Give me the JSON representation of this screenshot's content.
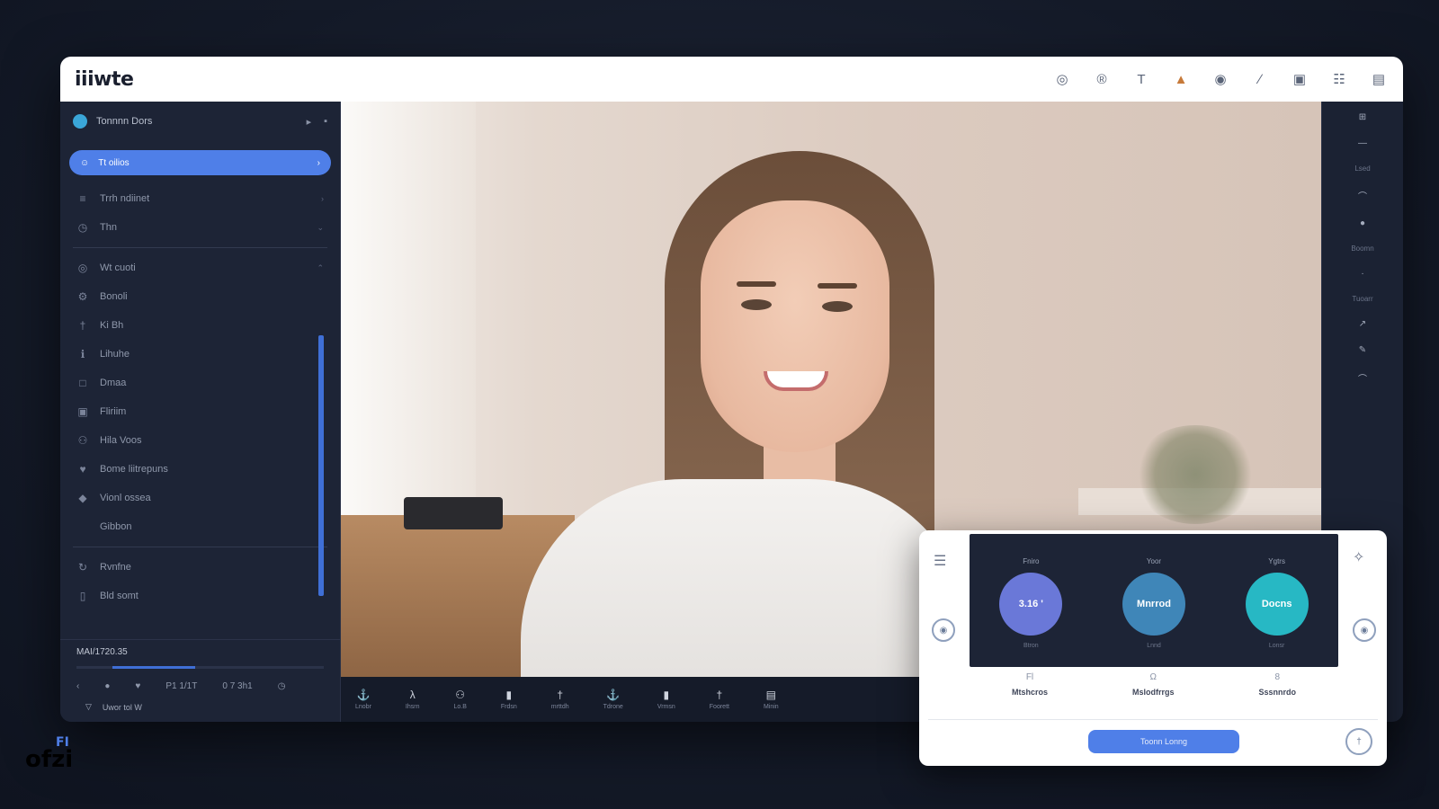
{
  "app": {
    "logo_text": "iiiwte"
  },
  "toolbar": {
    "icons": [
      "spiral-icon",
      "at-icon",
      "text-icon",
      "cat-icon",
      "circle-q-icon",
      "italic-icon",
      "image-icon",
      "grid-icon",
      "stack-icon"
    ]
  },
  "sidebar": {
    "header_label": "Tonnnn Dors",
    "active_item": "Tt oilios",
    "items_top": [
      "Trrh ndiinet",
      "Thn"
    ],
    "items": [
      "Wt cuoti",
      "Bonoli",
      "Ki Bh",
      "Lihuhe",
      "Dmaa",
      "Fliriim",
      "Hila Voos",
      "Bome liitrepuns",
      "Vionl ossea",
      "Gibbon"
    ],
    "items_bottom": [
      "Rvnfne",
      "Bld somt"
    ],
    "footer_title": "MAI/1720.35",
    "footer_controls": [
      "P1 1/1T",
      "0 7 3h1"
    ],
    "footer_bottom": "Uwor tol W"
  },
  "bottombar": {
    "labels": [
      "Lnobr",
      "Ihsrn",
      "Lo.B",
      "Frdsn",
      "mrttdh",
      "Tdrone",
      "Vrmsn",
      "Foorett",
      "Minin"
    ]
  },
  "right_rail": {
    "labels": [
      "Lsed",
      "Boomn",
      "Tuoarr"
    ]
  },
  "panel": {
    "cells": [
      {
        "top": "Fniro",
        "value": "3.16 '",
        "bottom": "Btron",
        "color": "#6a78d8"
      },
      {
        "top": "Yoor",
        "value": "Mnrrod",
        "bottom": "Lnnd",
        "color": "#3f86b8"
      },
      {
        "top": "Ygtrs",
        "value": "Docns",
        "bottom": "Lonsr",
        "color": "#27b8c4"
      }
    ],
    "labels": [
      {
        "icon": "Fl",
        "text": "Mtshcros"
      },
      {
        "icon": "Ω",
        "text": "Mslodfrrgs"
      },
      {
        "icon": "8",
        "text": "Sssnnrdo"
      }
    ],
    "cta_label": "Toonn Lonng"
  },
  "watermark": {
    "text": "ofzi",
    "sup": "FI"
  }
}
